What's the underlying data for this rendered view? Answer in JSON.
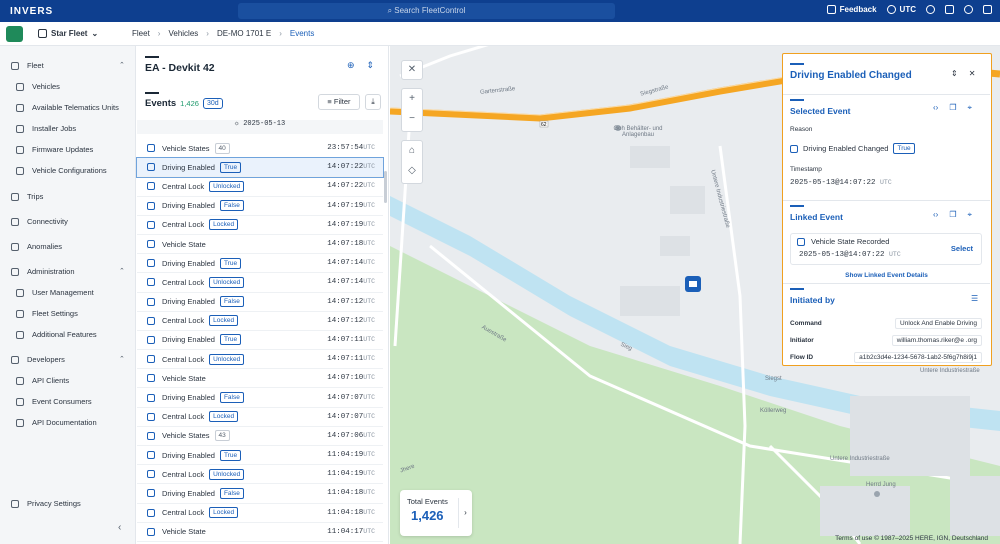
{
  "topbar": {
    "logo": "INVERS",
    "search_placeholder": "Search FleetControl",
    "feedback": "Feedback",
    "timezone": "UTC"
  },
  "subbar": {
    "org": "Star Fleet",
    "crumbs": [
      "Fleet",
      "Vehicles",
      "DE-MO 1701 E",
      "Events"
    ]
  },
  "sidebar": {
    "fleet": "Fleet",
    "vehicles": "Vehicles",
    "telematics": "Available Telematics Units",
    "installer": "Installer Jobs",
    "firmware": "Firmware Updates",
    "configs": "Vehicle Configurations",
    "trips": "Trips",
    "connectivity": "Connectivity",
    "anomalies": "Anomalies",
    "administration": "Administration",
    "users": "User Management",
    "fleet_settings": "Fleet Settings",
    "features": "Additional Features",
    "developers": "Developers",
    "api_clients": "API Clients",
    "consumers": "Event Consumers",
    "api_docs": "API Documentation",
    "privacy": "Privacy Settings"
  },
  "events": {
    "vehicle_title": "EA - Devkit 42",
    "title": "Events",
    "count": "1,426",
    "range": "30d",
    "filter": "Filter",
    "date": "2025-05-13",
    "rows": [
      {
        "name": "Vehicle States",
        "badge": "40",
        "grey": true,
        "time": "23:57:54",
        "icon": "state"
      },
      {
        "name": "Driving Enabled",
        "badge": "True",
        "time": "14:07:22",
        "sel": true,
        "icon": "car"
      },
      {
        "name": "Central Lock",
        "badge": "Unlocked",
        "time": "14:07:22",
        "icon": "lock"
      },
      {
        "name": "Driving Enabled",
        "badge": "False",
        "time": "14:07:19",
        "icon": "car"
      },
      {
        "name": "Central Lock",
        "badge": "Locked",
        "time": "14:07:19",
        "icon": "lock"
      },
      {
        "name": "Vehicle State",
        "badge": "",
        "time": "14:07:18",
        "icon": "state"
      },
      {
        "name": "Driving Enabled",
        "badge": "True",
        "time": "14:07:14",
        "icon": "car"
      },
      {
        "name": "Central Lock",
        "badge": "Unlocked",
        "time": "14:07:14",
        "icon": "lock"
      },
      {
        "name": "Driving Enabled",
        "badge": "False",
        "time": "14:07:12",
        "icon": "car"
      },
      {
        "name": "Central Lock",
        "badge": "Locked",
        "time": "14:07:12",
        "icon": "lock"
      },
      {
        "name": "Driving Enabled",
        "badge": "True",
        "time": "14:07:11",
        "icon": "car"
      },
      {
        "name": "Central Lock",
        "badge": "Unlocked",
        "time": "14:07:11",
        "icon": "lock"
      },
      {
        "name": "Vehicle State",
        "badge": "",
        "time": "14:07:10",
        "icon": "state"
      },
      {
        "name": "Driving Enabled",
        "badge": "False",
        "time": "14:07:07",
        "icon": "car"
      },
      {
        "name": "Central Lock",
        "badge": "Locked",
        "time": "14:07:07",
        "icon": "lock"
      },
      {
        "name": "Vehicle States",
        "badge": "43",
        "grey": true,
        "time": "14:07:06",
        "icon": "state"
      },
      {
        "name": "Driving Enabled",
        "badge": "True",
        "time": "11:04:19",
        "icon": "car"
      },
      {
        "name": "Central Lock",
        "badge": "Unlocked",
        "time": "11:04:19",
        "icon": "lock"
      },
      {
        "name": "Driving Enabled",
        "badge": "False",
        "time": "11:04:18",
        "icon": "car"
      },
      {
        "name": "Central Lock",
        "badge": "Locked",
        "time": "11:04:18",
        "icon": "lock"
      },
      {
        "name": "Vehicle State",
        "badge": "",
        "time": "11:04:17",
        "icon": "state"
      }
    ],
    "utc": "UTC"
  },
  "map": {
    "labels": [
      "Gartenstraße",
      "Siegstraße",
      "Goh Behälter- und Anlagenbau",
      "Untere Industriestraße",
      "Auestraße",
      "Sieg",
      "Köllerweg",
      "Untere Industriestraße",
      "Herrd Jung",
      "Jhere",
      "Siegst",
      "Untere Industriestraße"
    ],
    "road_badge": "62",
    "total_label": "Total Events",
    "total_value": "1,426",
    "attribution": "Terms of use   © 1987–2025 HERE, IGN, Deutschland"
  },
  "panel": {
    "title": "Driving Enabled Changed",
    "selected_event": "Selected Event",
    "reason_label": "Reason",
    "reason_value": "Driving Enabled Changed",
    "reason_badge": "True",
    "timestamp_label": "Timestamp",
    "timestamp_value": "2025-05-13@14:07:22",
    "timestamp_utc": "UTC",
    "linked_event": "Linked Event",
    "linked_name": "Vehicle State Recorded",
    "linked_time": "2025-05-13@14:07:22",
    "linked_utc": "UTC",
    "select": "Select",
    "show_linked": "Show Linked Event Details",
    "initiated_by": "Initiated by",
    "command_label": "Command",
    "command_value": "Unlock And Enable Driving",
    "initiator_label": "Initiator",
    "initiator_value": "william.thomas.riker@e          .org",
    "flow_label": "Flow ID",
    "flow_value": "a1b2c3d4e-1234-5678-1ab2-5f6g7h8i9j1"
  },
  "colors": {
    "brand": "#0e3f8f",
    "accent": "#1b5fb8",
    "highlight": "#f0a020",
    "road": "#f5a623",
    "river": "#bfe3f2",
    "green": "#c9e6c1"
  }
}
